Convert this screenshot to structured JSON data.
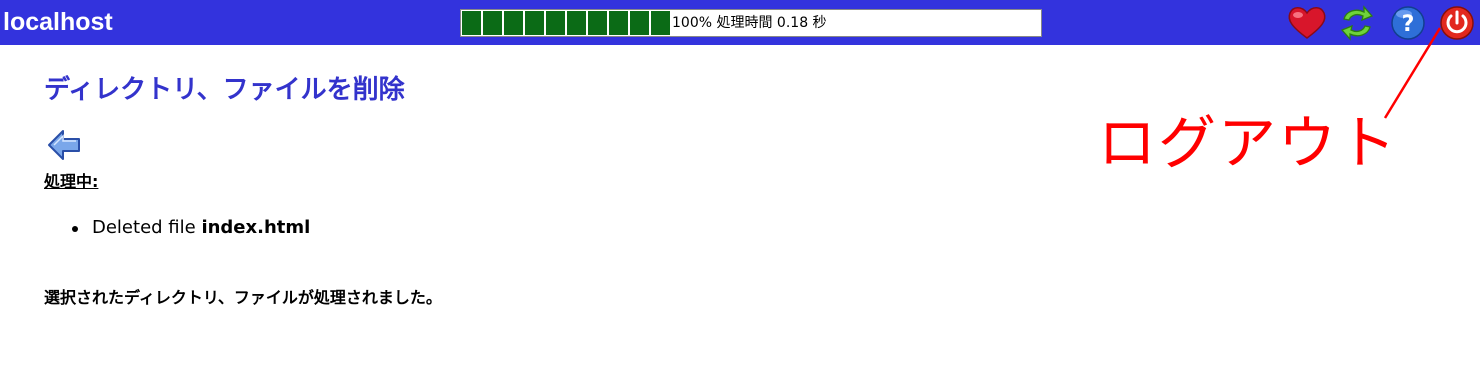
{
  "header": {
    "hostname": "localhost",
    "progress": {
      "percent": 100,
      "text": "100% 処理時間 0.18 秒",
      "fill_color": "#0b6b16"
    },
    "icons": {
      "favorite": "heart-icon",
      "refresh": "refresh-icon",
      "help": "help-icon",
      "logout": "power-icon"
    },
    "bar_color": "#3333dd"
  },
  "main": {
    "title": "ディレクトリ、ファイルを削除",
    "back_icon": "back-arrow-icon",
    "processing_label": "処理中:",
    "results": [
      {
        "prefix": "Deleted file",
        "filename": "index.html"
      }
    ],
    "completion_message": "選択されたディレクトリ、ファイルが処理されました。",
    "title_color": "#3333cc"
  },
  "annotation": {
    "label": "ログアウト",
    "color": "#ff0000"
  }
}
